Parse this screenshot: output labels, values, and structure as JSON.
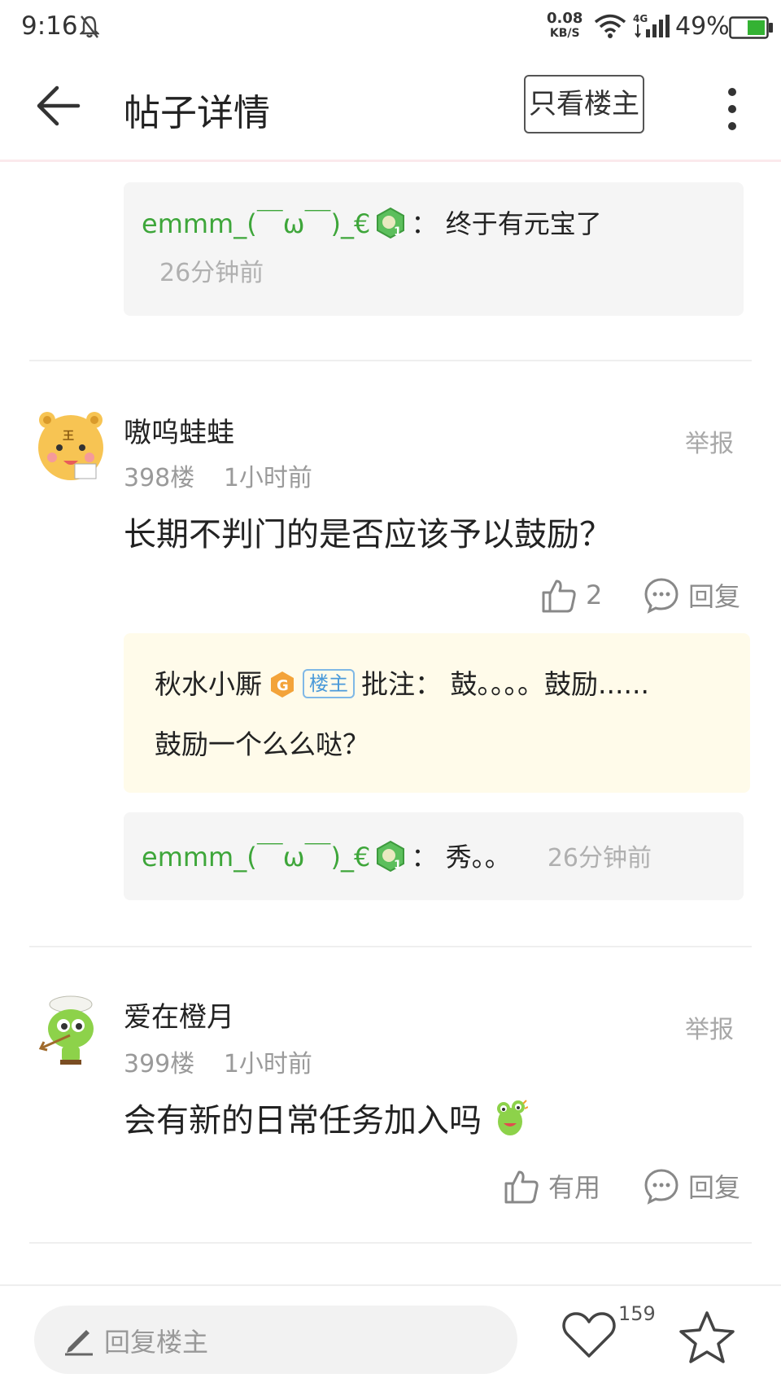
{
  "status": {
    "time": "9:16",
    "net_speed_value": "0.08",
    "net_speed_unit": "KB/S",
    "network_type": "4G",
    "battery": "49%"
  },
  "header": {
    "title": "帖子详情",
    "op_only_label": "只看楼主"
  },
  "top_subreply": {
    "name": "emmm_(￣ω￣)_€",
    "text": "：  终于有元宝了",
    "time": "26分钟前"
  },
  "posts": [
    {
      "user": "嗷呜蛙蛙",
      "floor": "398楼",
      "time": "1小时前",
      "report": "举报",
      "content": "长期不判门的是否应该予以鼓励？",
      "like_label": "2",
      "reply_label": "回复",
      "annotation": {
        "name": "秋水小厮",
        "badge_letter": "G",
        "op_tag": "楼主",
        "text1": "批注：  鼓。。。。鼓励......",
        "text2": "鼓励一个么么哒？"
      },
      "subreply": {
        "name": "emmm_(￣ω￣)_€",
        "text": "：  秀。。",
        "time": "26分钟前"
      }
    },
    {
      "user": "爱在橙月",
      "floor": "399楼",
      "time": "1小时前",
      "report": "举报",
      "content": "会有新的日常任务加入吗",
      "like_label": "有用",
      "reply_label": "回复"
    }
  ],
  "bottom": {
    "reply_placeholder": "回复楼主",
    "like_count": "159"
  },
  "colors": {
    "username_green": "#3ea63a",
    "tag_blue": "#4a9ad9",
    "annotation_bg": "#fffbea",
    "subreply_bg": "#f5f5f5"
  }
}
